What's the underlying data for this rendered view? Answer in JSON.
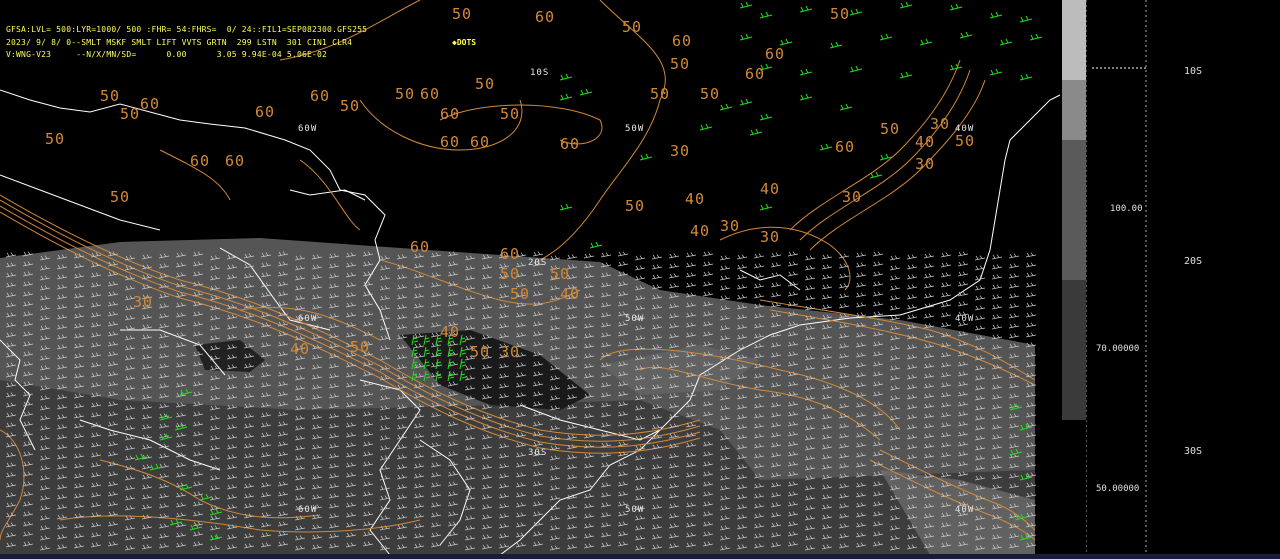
{
  "header": {
    "line1": "GFSA:LVL= 500:LYR=1000/ 500 :FHR= 54:FHRS=  0/ 24::FIL1=SEP082300.GFS255",
    "line2": "2023/ 9/ 8/ 0--SMLT MSKF SMLT LIFT VVTS GRTN  299 LSTN  301 CIN1 CLR4",
    "line3": "V:WNG-V23     --N/X/MN/SD=      0.00      3.05 9.94E-04 5.06E-02",
    "dots": "◆DOTS"
  },
  "contour_labels": [
    "50",
    "60",
    "50",
    "60",
    "50",
    "50",
    "60",
    "50",
    "50",
    "60",
    "50",
    "60",
    "50",
    "50",
    "60",
    "60",
    "50",
    "60",
    "60",
    "50",
    "60",
    "60",
    "60",
    "50",
    "50",
    "60",
    "60",
    "50",
    "60",
    "50",
    "30",
    "50",
    "30",
    "40",
    "30",
    "40",
    "30",
    "40",
    "50",
    "30",
    "40",
    "30",
    "60",
    "50",
    "50",
    "40",
    "50",
    "60",
    "30",
    "40",
    "50",
    "40",
    "50",
    "30"
  ],
  "grid_labels": {
    "lon_row1": [
      "60W",
      "50W",
      "40W"
    ],
    "lon_row2": [
      "60W",
      "50W",
      "40W"
    ],
    "lon_row3": [
      "60W",
      "50W",
      "40W"
    ],
    "lat": [
      "10S",
      "20S",
      "30S"
    ]
  },
  "colorbar": {
    "tick_top": "10S",
    "ticks": [
      "100.00",
      "70.00000",
      "50.00000"
    ],
    "lat_labels": [
      "10S",
      "20S",
      "30S"
    ],
    "colors": [
      "#bcbcbc",
      "#8a8a8a",
      "#5a5a5a",
      "#3a3a3a"
    ]
  },
  "legend": {
    "contour_color": "#d2893a",
    "coast_color": "#ffffff",
    "wind_color_high": "#22dd22",
    "wind_color_low": "#c8c8c8"
  }
}
